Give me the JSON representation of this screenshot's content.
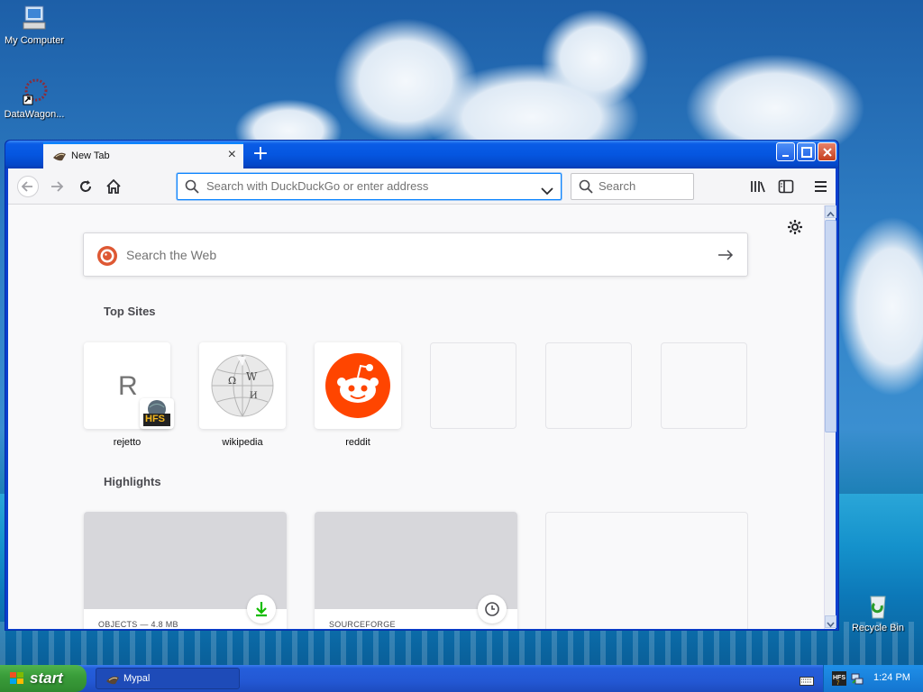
{
  "desktop": {
    "icons": [
      {
        "label": "My Computer"
      },
      {
        "label": "DataWagon..."
      },
      {
        "label": "Recycle Bin"
      }
    ]
  },
  "browser": {
    "tab": {
      "title": "New Tab"
    },
    "urlbar": {
      "placeholder": "Search with DuckDuckGo or enter address"
    },
    "searchbar": {
      "placeholder": "Search"
    },
    "newtab": {
      "web_search_placeholder": "Search the Web",
      "top_sites_title": "Top Sites",
      "top_sites": [
        {
          "label": "rejetto",
          "letter": "R",
          "badge": "HFS"
        },
        {
          "label": "wikipedia"
        },
        {
          "label": "reddit"
        },
        {
          "label": ""
        },
        {
          "label": ""
        },
        {
          "label": ""
        }
      ],
      "highlights_title": "Highlights",
      "highlights": [
        {
          "caption": "OBJECTS — 4.8 MB",
          "icon": "download-icon"
        },
        {
          "caption": "SOURCEFORGE",
          "icon": "clock-icon"
        },
        {
          "caption": ""
        }
      ]
    }
  },
  "taskbar": {
    "start_label": "start",
    "task_label": "Mypal",
    "clock": "1:24 PM"
  },
  "colors": {
    "accent": "#0a84ff",
    "reddit": "#ff4500",
    "titlebar": "#0556e0",
    "start": "#3a9d3a"
  }
}
